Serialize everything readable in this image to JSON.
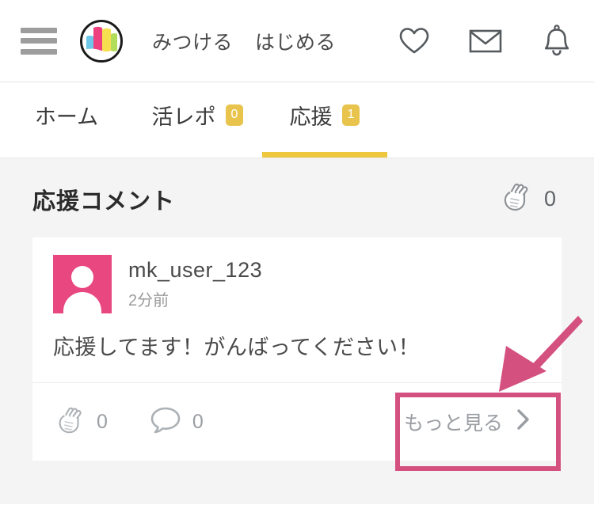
{
  "header": {
    "menu_icon": "hamburger-menu-icon",
    "logo_icon": "brand-logo-icon",
    "nav_links": [
      {
        "label": "みつける"
      },
      {
        "label": "はじめる"
      }
    ],
    "icons": [
      {
        "name": "heart-icon"
      },
      {
        "name": "envelope-icon"
      },
      {
        "name": "bell-icon"
      }
    ]
  },
  "tabs": [
    {
      "label": "ホーム",
      "badge": null,
      "active": false
    },
    {
      "label": "活レポ",
      "badge": "0",
      "active": false
    },
    {
      "label": "応援",
      "badge": "1",
      "active": true
    }
  ],
  "section": {
    "title": "応援コメント",
    "clap_icon": "clapping-hands-icon",
    "clap_count": "0"
  },
  "comment": {
    "avatar_icon": "user-avatar-icon",
    "username": "mk_user_123",
    "timestamp": "2分前",
    "text": "応援してます！がんばってください！",
    "actions": [
      {
        "icon": "clapping-hands-icon",
        "count": "0"
      },
      {
        "icon": "speech-bubble-icon",
        "count": "0"
      }
    ],
    "more_label": "もっと見る",
    "more_icon": "chevron-right-icon"
  },
  "annotation": {
    "highlight_color": "#d4507f",
    "arrow_color": "#d4507f"
  },
  "colors": {
    "accent_pink": "#e8477f",
    "badge_yellow": "#e8c44d",
    "tab_underline": "#edc73e",
    "page_background": "#f4f4f4"
  }
}
